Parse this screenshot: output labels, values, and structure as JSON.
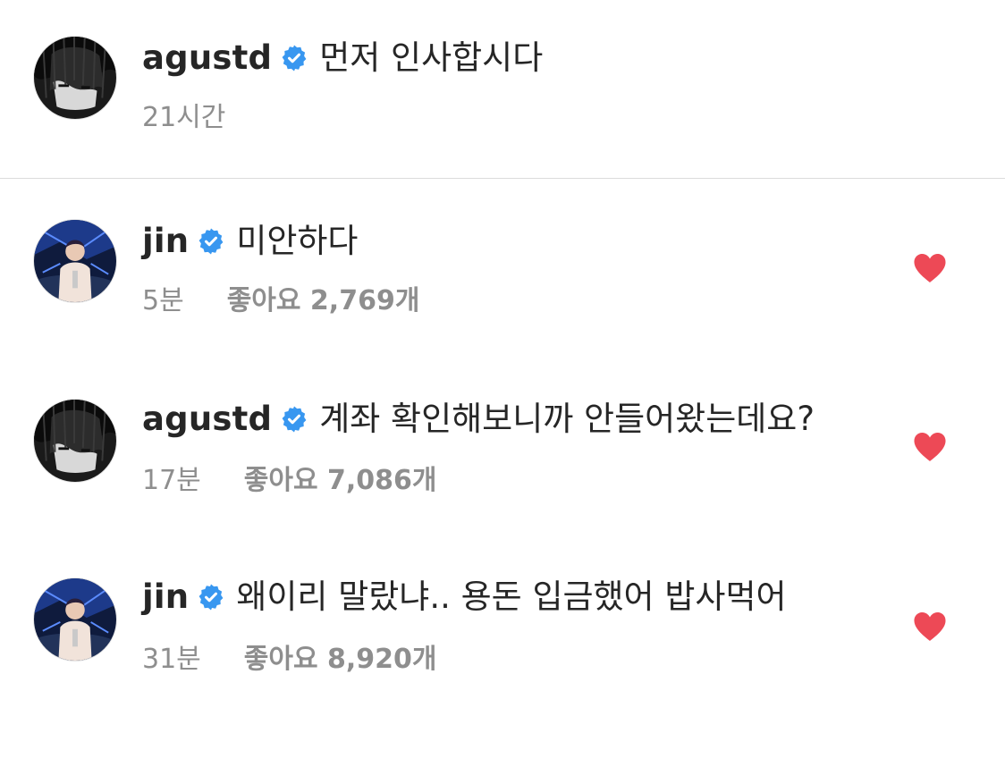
{
  "colors": {
    "text": "#262626",
    "meta": "#8e8e8e",
    "verified": "#3897f0",
    "heart": "#ed4956",
    "divider": "#dbdbdb"
  },
  "caption": {
    "username": "agustd",
    "text": "먼저 인사합시다",
    "time": "21시간",
    "avatar_icon": "avatar-agustd"
  },
  "comments": [
    {
      "username": "jin",
      "text": "미안하다",
      "time": "5분",
      "likes": "좋아요 2,769개",
      "liked": true,
      "avatar_icon": "avatar-jin"
    },
    {
      "username": "agustd",
      "text": "계좌 확인해보니까 안들어왔는데요?",
      "time": "17분",
      "likes": "좋아요 7,086개",
      "liked": true,
      "avatar_icon": "avatar-agustd"
    },
    {
      "username": "jin",
      "text": "왜이리 말랐냐.. 용돈 입금했어 밥사먹어",
      "time": "31분",
      "likes": "좋아요 8,920개",
      "liked": true,
      "avatar_icon": "avatar-jin"
    }
  ]
}
